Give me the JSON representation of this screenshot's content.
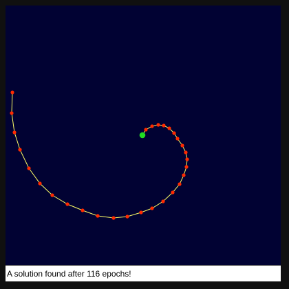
{
  "status": {
    "message": "A solution found after 116 epochs!"
  },
  "colors": {
    "background": "#010233",
    "curve": "#ffff66",
    "node": "#ff2a00",
    "start_node": "#22dd22",
    "status_bar": "#ffffff",
    "frame": "#101010"
  },
  "icons": {
    "start_node": "green-circle",
    "node": "red-dot"
  }
}
